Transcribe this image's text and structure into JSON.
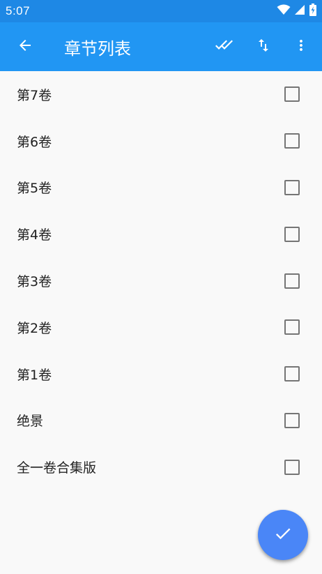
{
  "status_bar": {
    "time": "5:07",
    "icons": [
      "wifi-icon",
      "signal-icon",
      "battery-charging-icon"
    ]
  },
  "app_bar": {
    "title": "章节列表",
    "back_icon": "arrow-back-icon",
    "actions": [
      "select-all-double-check-icon",
      "sort-swap-vertical-icon",
      "more-vert-icon"
    ]
  },
  "chapters": [
    {
      "label": "第7卷",
      "checked": false
    },
    {
      "label": "第6卷",
      "checked": false
    },
    {
      "label": "第5卷",
      "checked": false
    },
    {
      "label": "第4卷",
      "checked": false
    },
    {
      "label": "第3卷",
      "checked": false
    },
    {
      "label": "第2卷",
      "checked": false
    },
    {
      "label": "第1卷",
      "checked": false
    },
    {
      "label": "绝景",
      "checked": false
    },
    {
      "label": "全一卷合集版",
      "checked": false
    }
  ],
  "fab": {
    "icon": "check-icon"
  },
  "colors": {
    "status_bar": "#1e88e5",
    "app_bar": "#2196f3",
    "fab": "#4a86f7",
    "background": "#f9f9f9",
    "checkbox_border": "#757575"
  }
}
